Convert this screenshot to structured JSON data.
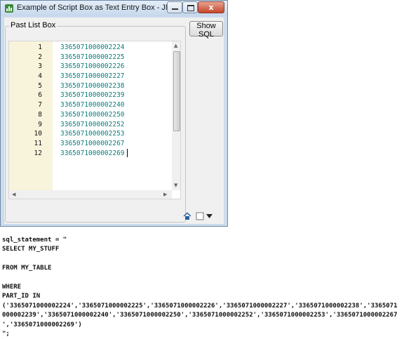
{
  "window": {
    "title": "Example of Script Box as Text Entry Box - JMP",
    "close_glyph": "x"
  },
  "panel": {
    "group_label": "Past List Box",
    "button_label": "Show SQL"
  },
  "editor": {
    "lines": [
      {
        "num": "1",
        "text": "3365071000002224"
      },
      {
        "num": "2",
        "text": "3365071000002225"
      },
      {
        "num": "3",
        "text": "3365071000002226"
      },
      {
        "num": "4",
        "text": "3365071000002227"
      },
      {
        "num": "5",
        "text": "3365071000002238"
      },
      {
        "num": "6",
        "text": "3365071000002239"
      },
      {
        "num": "7",
        "text": "3365071000002240"
      },
      {
        "num": "8",
        "text": "3365071000002250"
      },
      {
        "num": "9",
        "text": "3365071000002252"
      },
      {
        "num": "10",
        "text": "3365071000002253"
      },
      {
        "num": "11",
        "text": "3365071000002267"
      },
      {
        "num": "12",
        "text": "3365071000002269"
      }
    ]
  },
  "output": {
    "text": "sql_statement = \"\nSELECT MY_STUFF\n\nFROM MY_TABLE\n\nWHERE\nPART_ID IN\n('3365071000002224','3365071000002225','3365071000002226','3365071000002227','3365071000002238','3365071\n000002239','3365071000002240','3365071000002250','3365071000002252','3365071000002253','3365071000002267\n','3365071000002269')\n\";"
  },
  "colors": {
    "code_text": "#0e7c7c",
    "gutter": "#f8f4dc",
    "window_frame": "#cddcec"
  }
}
